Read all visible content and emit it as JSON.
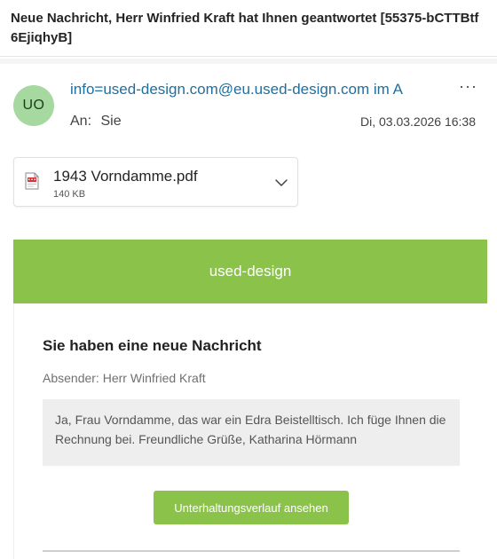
{
  "email": {
    "subject": "Neue Nachricht, Herr Winfried Kraft hat Ihnen geantwortet [55375-bCTTBtf6EjiqhyB]",
    "avatar_initials": "UO",
    "sender": "info=used-design.com@eu.used-design.com im A",
    "more_label": "···",
    "to_label": "An:",
    "to_value": "Sie",
    "date": "Di, 03.03.2026 16:38"
  },
  "attachment": {
    "name": "1943 Vorndamme.pdf",
    "size": "140 KB",
    "icon": "pdf-file-icon"
  },
  "content": {
    "brand": "used-design",
    "brand_color": "#8bc34a",
    "heading": "Sie haben eine neue Nachricht",
    "absender": "Absender: Herr Winfried Kraft",
    "message": "Ja, Frau Vorndamme, das war ein Edra Beistelltisch. Ich füge Ihnen die Rechnung bei. Freundliche Grüße, Katharina Hörmann",
    "button_label": "Unterhaltungsverlauf ansehen"
  }
}
